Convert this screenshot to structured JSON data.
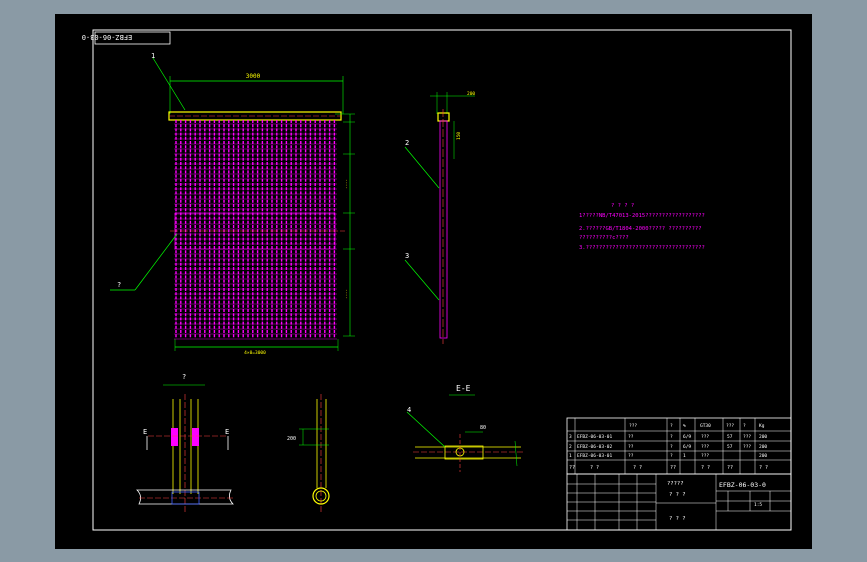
{
  "drawing": {
    "title_tab": "EFBZ-06-03-0",
    "drawing_no": "EFBZ-06-03-0",
    "section_label": "E-E",
    "detail_label": "?",
    "cut_label": "E"
  },
  "callouts": {
    "front_top": "1",
    "front_left": "?",
    "side_1": "2",
    "side_2": "3",
    "section_4": "4"
  },
  "dimensions": {
    "top_width": "3000",
    "bottom_width": "4×0=3000",
    "side_width": "200",
    "side_h": "150",
    "detail_h": "200",
    "ee_dim": "80"
  },
  "notes": [
    "? ? ? ?",
    "1?????NB/T47013-2015??????????????????",
    "2.??????GB/T1804-2000????? ??????????",
    "  ??????????c????",
    "3.????????????????????????????????????"
  ],
  "parts_table": {
    "header": [
      "",
      "",
      "???",
      "?",
      "%",
      "GT30",
      "???",
      "?",
      "?",
      "Kg"
    ],
    "rows": [
      [
        "3",
        "EFBZ-06-03-01",
        "??",
        "?",
        "6/9",
        "???",
        "57",
        "???",
        "200"
      ],
      [
        "2",
        "EFBZ-06-03-02",
        "??",
        "?",
        "6/9",
        "???",
        "57",
        "???",
        "200"
      ],
      [
        "1",
        "EFBZ-06-03-01",
        "??",
        "?",
        "1",
        "???",
        "",
        "",
        "200"
      ]
    ],
    "footer": [
      "??",
      "? ?",
      "? ?",
      "??",
      "? ?",
      "??",
      "? ?"
    ]
  },
  "title_block": {
    "company": "?????",
    "name": "? ? ?",
    "bottom_name": "? ? ?",
    "code": "EFBZ-06-03-0",
    "scale": "1:5"
  }
}
